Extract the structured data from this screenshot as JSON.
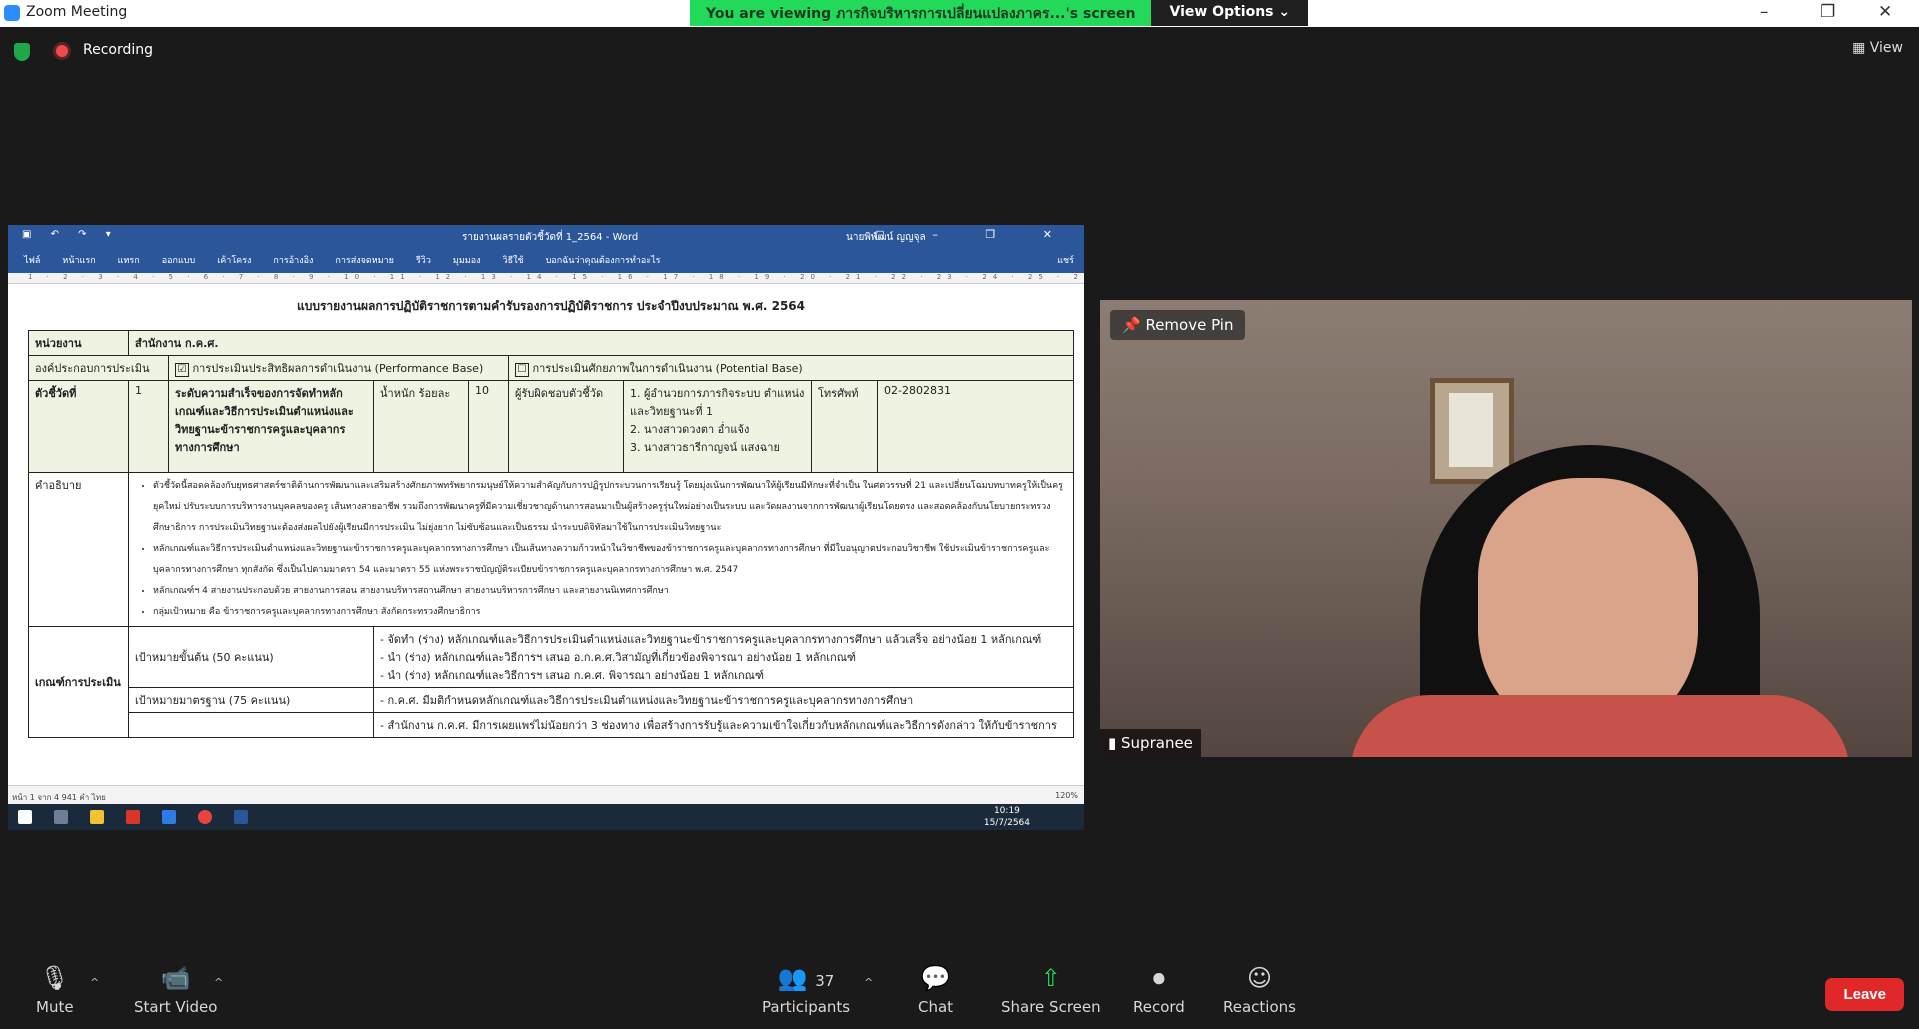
{
  "window": {
    "title": "Zoom Meeting",
    "controls": [
      "–",
      "❐",
      "✕"
    ]
  },
  "share_banner": {
    "viewing_text": "You are viewing ภารกิจบริหารการเปลี่ยนแปลงภาคร...'s screen",
    "view_options_label": "View Options ⌄"
  },
  "status": {
    "recording_label": "Recording",
    "view_label": "View"
  },
  "word": {
    "title": "รายงานผลรายตัวชี้วัดที่ 1_2564  -  Word",
    "user": "นายพิพัฒน์ ญญจุล",
    "qa_icons": "▣ ↶ ↷ ▾",
    "controls": "▢ – ❐ ✕",
    "tabs": [
      "ไฟล์",
      "หน้าแรก",
      "แทรก",
      "ออกแบบ",
      "เค้าโครง",
      "การอ้างอิง",
      "การส่งจดหมาย",
      "รีวิว",
      "มุมมอง",
      "วิธีใช้",
      "บอกฉันว่าคุณต้องการทำอะไร",
      "แชร์"
    ],
    "ruler": "1 · 2 · 3 · 4 · 5 · 6 · 7 · 8 · 9 · 10 · 11 · 12 · 13 · 14 · 15 · 16 · 17 · 18 · 19 · 20 · 21 · 22 · 23 · 24 · 25 · 26",
    "doc_title": "แบบรายงานผลการปฏิบัติราชการตามคำรับรองการปฏิบัติราชการ ประจำปีงบประมาณ พ.ศ. 2564",
    "agency_label": "หน่วยงาน",
    "agency_value": "สำนักงาน ก.ค.ศ.",
    "assess_label": "องค์ประกอบการประเมิน",
    "perf_check": "☑",
    "perf_label": "การประเมินประสิทธิผลการดำเนินงาน (Performance Base)",
    "pot_check": "☐",
    "pot_label": "การประเมินศักยภาพในการดำเนินงาน (Potential Base)",
    "indicator_label": "ตัวชี้วัดที่",
    "indicator_no": "1",
    "indicator_text": "ระดับความสำเร็จของการจัดทำหลักเกณฑ์และวิธีการประเมินตำแหน่งและวิทยฐานะข้าราชการครูและบุคลากรทางการศึกษา",
    "weight_label": "น้ำหนัก ร้อยละ",
    "weight_value": "10",
    "resp_label": "ผู้รับผิดชอบตัวชี้วัด",
    "resp_names": [
      "1. ผู้อำนวยการภารกิจระบบ ตำแหน่งและวิทยฐานะที่ 1",
      "2. นางสาวดวงตา  อ่ำแจ้ง",
      "3. นางสาวธารีกาญจน์  แสงฉาย"
    ],
    "phone_label": "โทรศัพท์",
    "phone_value": "02-2802831",
    "desc_label": "คำอธิบาย",
    "desc_items": [
      "ตัวชี้วัดนี้สอดคล้องกับยุทธศาสตร์ชาติด้านการพัฒนาและเสริมสร้างศักยภาพทรัพยากรมนุษย์ให้ความสำคัญกับการปฏิรูปกระบวนการเรียนรู้ โดยมุ่งเน้นการพัฒนาให้ผู้เรียนมีทักษะที่จำเป็น ในศตวรรษที่ 21 และเปลี่ยนโฉมบทบาทครูให้เป็นครูยุคใหม่ ปรับระบบการบริหารงานบุคคลของครู เส้นทางสายอาชีพ รวมถึงการพัฒนาครูที่มีความเชี่ยวชาญด้านการสอนมาเป็นผู้สร้างครูรุ่นใหม่อย่างเป็นระบบ และวัดผลงานจากการพัฒนาผู้เรียนโดยตรง และสอดคล้องกับนโยบายกระทรวงศึกษาธิการ การประเมินวิทยฐานะต้องส่งผลไปยังผู้เรียนมีการประเมิน ไม่ยุ่งยาก ไม่ซับซ้อนและเป็นธรรม นำระบบดิจิทัลมาใช้ในการประเมินวิทยฐานะ",
      "หลักเกณฑ์และวิธีการประเมินตำแหน่งและวิทยฐานะข้าราชการครูและบุคลากรทางการศึกษา เป็นเส้นทางความก้าวหน้าในวิชาชีพของข้าราชการครูและบุคลากรทางการศึกษา ที่มีใบอนุญาตประกอบวิชาชีพ ใช้ประเมินข้าราชการครูและบุคลากรทางการศึกษา ทุกสังกัด ซึ่งเป็นไปตามมาตรา 54 และมาตรา 55 แห่งพระราชบัญญัติระเบียบข้าราชการครูและบุคลากรทางการศึกษา พ.ศ. 2547",
      "หลักเกณฑ์ฯ 4 สายงานประกอบด้วย สายงานการสอน สายงานบริหารสถานศึกษา สายงานบริหารการศึกษา และสายงานนิเทศการศึกษา",
      "กลุ่มเป้าหมาย คือ ข้าราชการครูและบุคลากรทางการศึกษา สังกัดกระทรวงศึกษาธิการ"
    ],
    "criteria_label": "เกณฑ์การประเมิน",
    "goal1_label": "เป้าหมายขั้นต้น (50 คะแนน)",
    "goal1_items": [
      "- จัดทำ (ร่าง) หลักเกณฑ์และวิธีการประเมินตำแหน่งและวิทยฐานะข้าราชการครูและบุคลากรทางการศึกษา แล้วเสร็จ อย่างน้อย 1 หลักเกณฑ์",
      "- นำ (ร่าง) หลักเกณฑ์และวิธีการฯ เสนอ อ.ก.ค.ศ.วิสามัญที่เกี่ยวข้องพิจารณา อย่างน้อย 1 หลักเกณฑ์",
      "- นำ (ร่าง) หลักเกณฑ์และวิธีการฯ เสนอ ก.ค.ศ. พิจารณา อย่างน้อย 1 หลักเกณฑ์"
    ],
    "goal2_label": "เป้าหมายมาตรฐาน (75 คะแนน)",
    "goal2_items": [
      "- ก.ค.ศ. มีมติกำหนดหลักเกณฑ์และวิธีการประเมินตำแหน่งและวิทยฐานะข้าราชการครูและบุคลากรทางการศึกษา"
    ],
    "goal3_items": [
      "- สำนักงาน ก.ค.ศ. มีการเผยแพร่ไม่น้อยกว่า 3 ช่องทาง เพื่อสร้างการรับรู้และความเข้าใจเกี่ยวกับหลักเกณฑ์และวิธีการดังกล่าว ให้กับข้าราชการ"
    ],
    "status_left": "หน้า 1 จาก 4    941 คำ    ไทย",
    "status_right": "120%",
    "clock_time": "10:19",
    "clock_date": "15/7/2564"
  },
  "video": {
    "pin_label": "Remove Pin",
    "participant_name": "Supranee"
  },
  "toolbar": {
    "mute": "Mute",
    "start_video": "Start Video",
    "participants": "Participants",
    "participants_count": "37",
    "chat": "Chat",
    "share_screen": "Share Screen",
    "record": "Record",
    "reactions": "Reactions",
    "leave": "Leave"
  }
}
